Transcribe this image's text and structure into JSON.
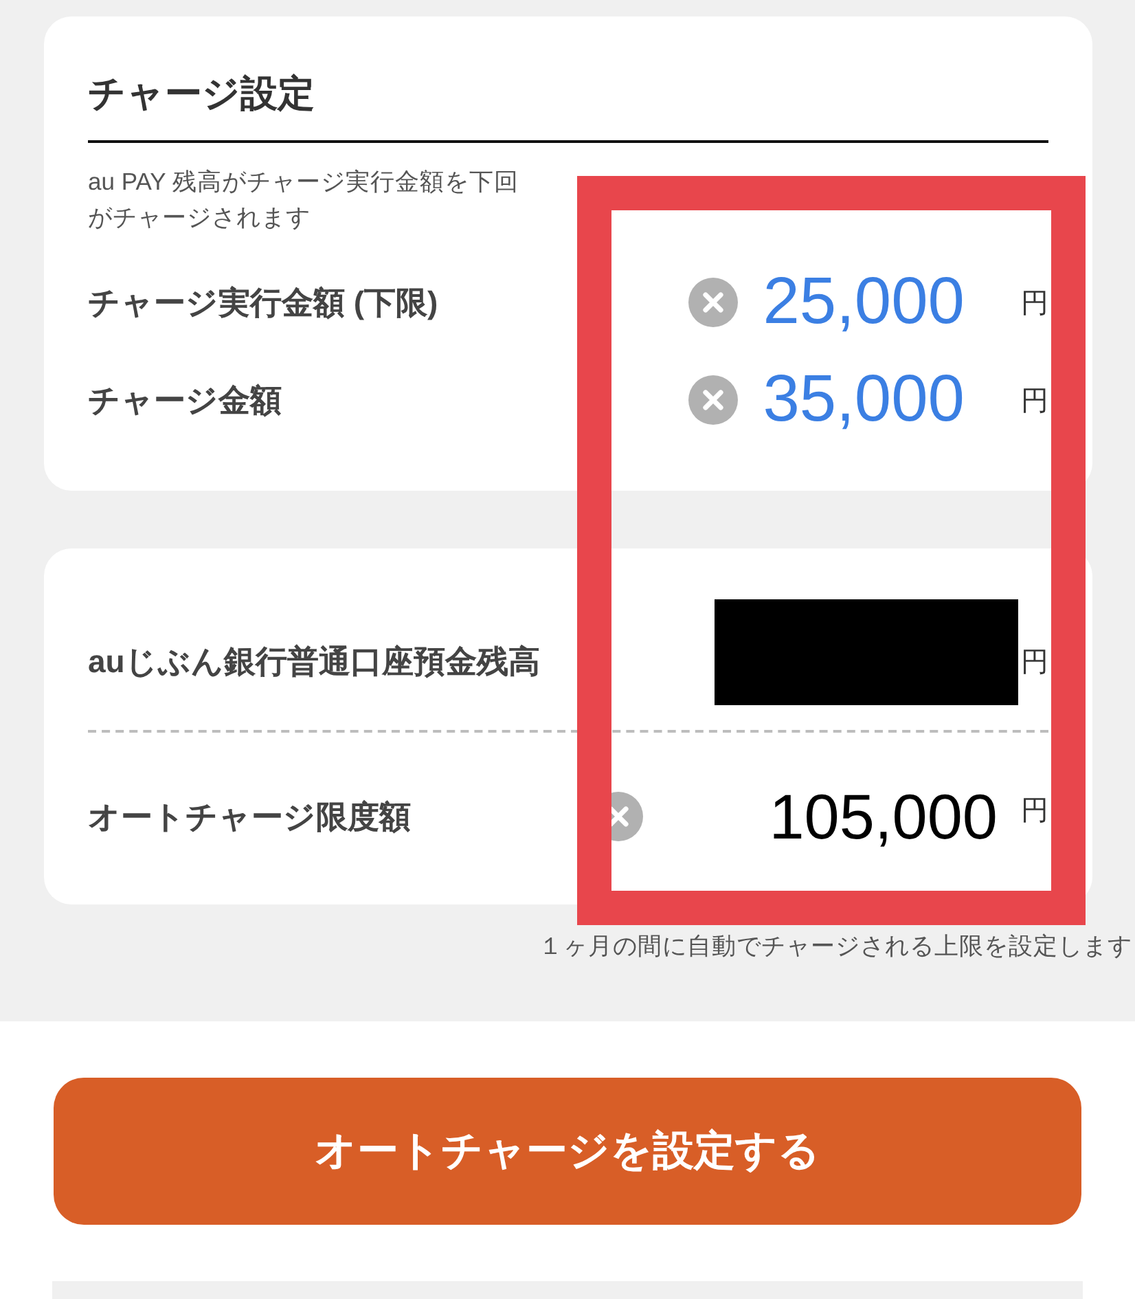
{
  "charge_settings": {
    "title": "チャージ設定",
    "description_lines": [
      "au PAY 残高がチャージ実行金額を下回",
      "がチャージされます"
    ],
    "rows": [
      {
        "label": "チャージ実行金額 (下限)",
        "value": "25,000",
        "unit": "円",
        "highlighted": true
      },
      {
        "label": "チャージ金額",
        "value": "35,000",
        "unit": "円",
        "highlighted": true
      }
    ]
  },
  "limit_settings": {
    "rows": [
      {
        "kind": "redacted",
        "label": "auじぶん銀行普通口座預金残高",
        "unit": "円"
      },
      {
        "kind": "amount",
        "label": "オートチャージ限度額",
        "value": "105,000",
        "unit": "円",
        "highlighted": false
      }
    ],
    "note": "１ヶ月の間に自動でチャージされる上限を設定します"
  },
  "submit_button": {
    "label": "オートチャージを設定する"
  }
}
